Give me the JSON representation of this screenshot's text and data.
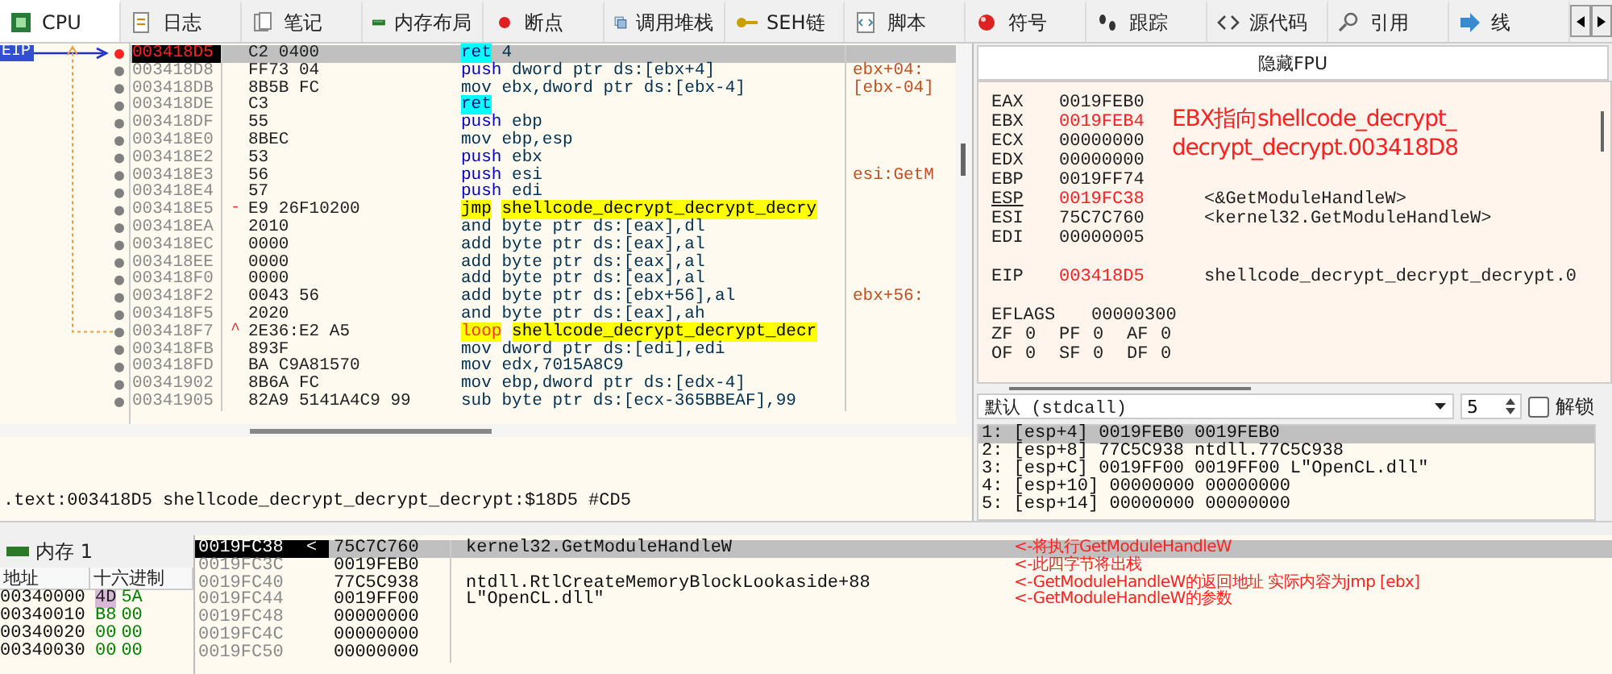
{
  "tabs": [
    {
      "label": "CPU",
      "selected": true
    },
    {
      "label": "日志",
      "selected": false
    },
    {
      "label": "笔记",
      "selected": false
    },
    {
      "label": "内存布局",
      "selected": false
    },
    {
      "label": "断点",
      "selected": false
    },
    {
      "label": "调用堆栈",
      "selected": false
    },
    {
      "label": "SEH链",
      "selected": false
    },
    {
      "label": "脚本",
      "selected": false
    },
    {
      "label": "符号",
      "selected": false
    },
    {
      "label": "跟踪",
      "selected": false
    },
    {
      "label": "源代码",
      "selected": false
    },
    {
      "label": "引用",
      "selected": false
    },
    {
      "label": "线",
      "selected": false
    }
  ],
  "disassembly": {
    "eip_label": "EIP",
    "rows": [
      {
        "address": "003418D5",
        "bytes": "C2 0400",
        "mnemonic": "ret",
        "kind": "ret",
        "operands": "4",
        "selected": true
      },
      {
        "address": "003418D8",
        "bytes": "FF73 04",
        "mnemonic": "push",
        "kind": "push",
        "operands": "dword ptr ds:[ebx+4]",
        "comment": "ebx+04:",
        "selected": false
      },
      {
        "address": "003418DB",
        "bytes": "8B5B FC",
        "mnemonic": "mov",
        "kind": "plain",
        "operands": "ebx,dword ptr ds:[ebx-4]",
        "comment": "[ebx-04]",
        "selected": false
      },
      {
        "address": "003418DE",
        "bytes": "C3",
        "mnemonic": "ret",
        "kind": "ret",
        "selected": false
      },
      {
        "address": "003418DF",
        "bytes": "55",
        "mnemonic": "push",
        "kind": "push",
        "operands": "ebp",
        "selected": false
      },
      {
        "address": "003418E0",
        "bytes": "8BEC",
        "mnemonic": "mov",
        "kind": "plain",
        "operands": "ebp,esp",
        "selected": false
      },
      {
        "address": "003418E2",
        "bytes": "53",
        "mnemonic": "push",
        "kind": "push",
        "operands": "ebx",
        "selected": false
      },
      {
        "address": "003418E3",
        "bytes": "56",
        "mnemonic": "push",
        "kind": "push",
        "operands": "esi",
        "comment": "esi:GetM",
        "selected": false
      },
      {
        "address": "003418E4",
        "bytes": "57",
        "mnemonic": "push",
        "kind": "push",
        "operands": "edi",
        "selected": false
      },
      {
        "address": "003418E5",
        "bytes": "E9 26F10200",
        "branch": "-",
        "mnemonic": "jmp",
        "kind": "jump",
        "operands": "shellcode_decrypt_decrypt_decry",
        "selected": false
      },
      {
        "address": "003418EA",
        "bytes": "2010",
        "mnemonic": "and",
        "kind": "plain",
        "operands": "byte ptr ds:[eax],dl",
        "selected": false
      },
      {
        "address": "003418EC",
        "bytes": "0000",
        "mnemonic": "add",
        "kind": "plain",
        "operands": "byte ptr ds:[eax],al",
        "selected": false
      },
      {
        "address": "003418EE",
        "bytes": "0000",
        "mnemonic": "add",
        "kind": "plain",
        "operands": "byte ptr ds:[eax],al",
        "selected": false
      },
      {
        "address": "003418F0",
        "bytes": "0000",
        "mnemonic": "add",
        "kind": "plain",
        "operands": "byte ptr ds:[eax],al",
        "selected": false
      },
      {
        "address": "003418F2",
        "bytes": "0043 56",
        "mnemonic": "add",
        "kind": "plain",
        "operands": "byte ptr ds:[ebx+56],al",
        "comment": "ebx+56:",
        "selected": false
      },
      {
        "address": "003418F5",
        "bytes": "2020",
        "mnemonic": "and",
        "kind": "plain",
        "operands": "byte ptr ds:[eax],ah",
        "selected": false
      },
      {
        "address": "003418F7",
        "bytes": "2E36:E2 A5",
        "branch": "^",
        "mnemonic": "loop",
        "kind": "loop",
        "operands": "shellcode_decrypt_decrypt_decr",
        "selected": false
      },
      {
        "address": "003418FB",
        "bytes": "893F",
        "mnemonic": "mov",
        "kind": "plain",
        "operands": "dword ptr ds:[edi],edi",
        "selected": false
      },
      {
        "address": "003418FD",
        "bytes": "BA C9A81570",
        "mnemonic": "mov",
        "kind": "plain",
        "operands": "edx,7015A8C9",
        "selected": false
      },
      {
        "address": "00341902",
        "bytes": "8B6A FC",
        "mnemonic": "mov",
        "kind": "plain",
        "operands": "ebp,dword ptr ds:[edx-4]",
        "selected": false
      },
      {
        "address": "00341905",
        "bytes": "82A9 5141A4C9 99",
        "mnemonic": "sub",
        "kind": "plain",
        "operands": "byte ptr ds:[ecx-365BBEAF],99",
        "selected": false
      }
    ]
  },
  "registers": {
    "hide_fpu_button": "隐藏FPU",
    "annotation": [
      "EBX指向shellcode_decrypt_",
      "decrypt_decrypt.003418D8"
    ],
    "groups": [
      [
        {
          "name": "EAX",
          "value": "0019FEB0",
          "changed": false,
          "underlined": false
        },
        {
          "name": "EBX",
          "value": "0019FEB4",
          "changed": true,
          "underlined": false
        },
        {
          "name": "ECX",
          "value": "00000000",
          "changed": false,
          "underlined": false
        },
        {
          "name": "EDX",
          "value": "00000000",
          "changed": false,
          "underlined": false
        },
        {
          "name": "EBP",
          "value": "0019FF74",
          "changed": false,
          "underlined": false
        },
        {
          "name": "ESP",
          "value": "0019FC38",
          "note": "<&GetModuleHandleW>",
          "changed": true,
          "underlined": true
        },
        {
          "name": "ESI",
          "value": "75C7C760",
          "note": "<kernel32.GetModuleHandleW>",
          "changed": false,
          "underlined": false
        },
        {
          "name": "EDI",
          "value": "00000005",
          "changed": false,
          "underlined": false
        }
      ],
      [
        {
          "name": "EIP",
          "value": "003418D5",
          "note": "shellcode_decrypt_decrypt_decrypt.0",
          "changed": true,
          "underlined": false
        }
      ]
    ],
    "eflags": {
      "name": "EFLAGS",
      "value": "00000300"
    },
    "flags": [
      [
        {
          "name": "ZF",
          "value": "0"
        },
        {
          "name": "PF",
          "value": "0"
        },
        {
          "name": "AF",
          "value": "0"
        }
      ],
      [
        {
          "name": "OF",
          "value": "0"
        },
        {
          "name": "SF",
          "value": "0"
        },
        {
          "name": "DF",
          "value": "0"
        }
      ]
    ]
  },
  "call_convention": {
    "value": "默认 (stdcall)",
    "count": "5",
    "unlock_label": "解锁",
    "unlock_checked": false
  },
  "arguments": [
    {
      "text": "1: [esp+4] 0019FEB0 0019FEB0",
      "selected": true
    },
    {
      "text": "2: [esp+8] 77C5C938 ntdll.77C5C938",
      "selected": false
    },
    {
      "text": "3: [esp+C] 0019FF00 0019FF00 L\"OpenCL.dll\"",
      "selected": false
    },
    {
      "text": "4: [esp+10] 00000000 00000000",
      "selected": false
    },
    {
      "text": "5: [esp+14] 00000000 00000000",
      "selected": false
    }
  ],
  "info_line": ".text:003418D5 shellcode_decrypt_decrypt_decrypt:$18D5 #CD5",
  "dump": {
    "tab": "内存 1",
    "columns": [
      "地址",
      "十六进制"
    ],
    "rows": [
      {
        "address": "00340000",
        "bytes": [
          {
            "v": "4D",
            "selected": true
          },
          {
            "v": "5A",
            "selected": false
          }
        ]
      },
      {
        "address": "00340010",
        "bytes": [
          {
            "v": "B8",
            "selected": false
          },
          {
            "v": "00",
            "selected": false
          }
        ]
      },
      {
        "address": "00340020",
        "bytes": [
          {
            "v": "00",
            "selected": false
          },
          {
            "v": "00",
            "selected": false
          }
        ]
      },
      {
        "address": "00340030",
        "bytes": [
          {
            "v": "00",
            "selected": false
          },
          {
            "v": "00",
            "selected": false
          }
        ]
      }
    ]
  },
  "stack": {
    "pointer_mark": "<",
    "rows": [
      {
        "address": "0019FC38",
        "value": "75C7C760",
        "comment": "kernel32.GetModuleHandleW",
        "note": "<-将执行GetModuleHandleW",
        "selected": true
      },
      {
        "address": "0019FC3C",
        "value": "0019FEB0",
        "note": "<-此四字节将出栈",
        "selected": false
      },
      {
        "address": "0019FC40",
        "value": "77C5C938",
        "comment": "ntdll.RtlCreateMemoryBlockLookaside+88",
        "note": "<-GetModuleHandleW的返回地址 实际内容为jmp [ebx]",
        "selected": false
      },
      {
        "address": "0019FC44",
        "value": "0019FF00",
        "comment": "L\"OpenCL.dll\"",
        "note": "<-GetModuleHandleW的参数",
        "selected": false
      },
      {
        "address": "0019FC48",
        "value": "00000000",
        "selected": false
      },
      {
        "address": "0019FC4C",
        "value": "00000000",
        "selected": false
      },
      {
        "address": "0019FC50",
        "value": "00000000",
        "selected": false
      }
    ]
  }
}
